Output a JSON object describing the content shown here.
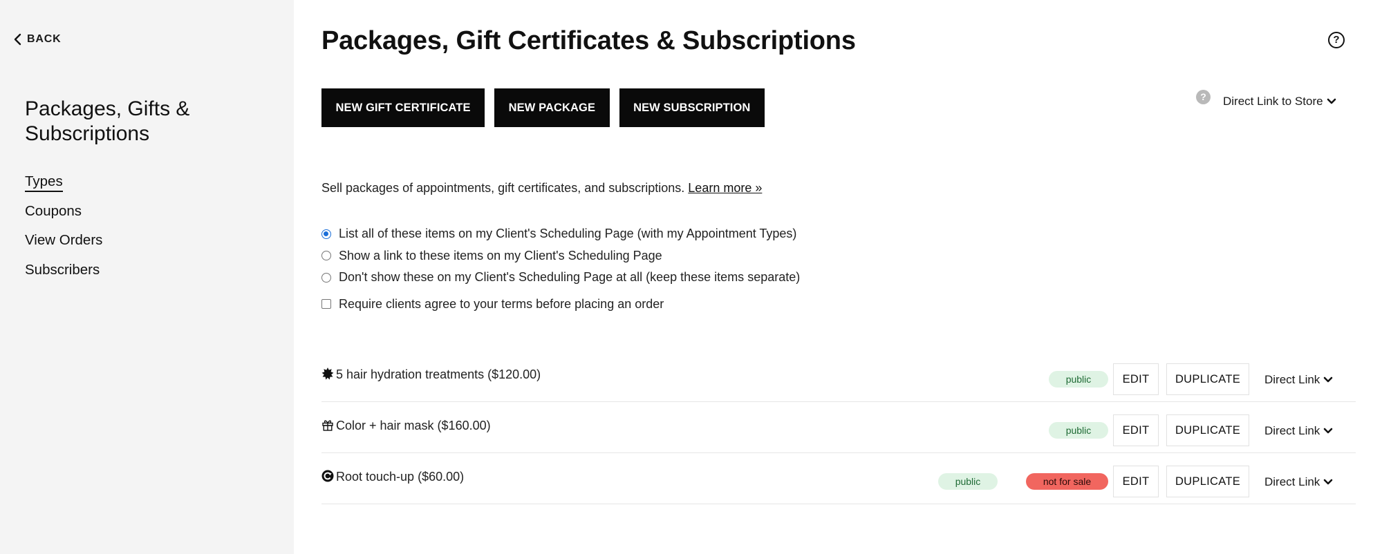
{
  "sidebar": {
    "back_label": "BACK",
    "title": "Packages, Gifts & Subscriptions",
    "nav": [
      {
        "label": "Types",
        "active": true
      },
      {
        "label": "Coupons",
        "active": false
      },
      {
        "label": "View Orders",
        "active": false
      },
      {
        "label": "Subscribers",
        "active": false
      }
    ]
  },
  "header": {
    "title": "Packages, Gift Certificates & Subscriptions",
    "help_icon": "?"
  },
  "toolbar": {
    "new_gift": "NEW GIFT CERTIFICATE",
    "new_package": "NEW PACKAGE",
    "new_subscription": "NEW SUBSCRIPTION",
    "store_help_icon": "?",
    "store_link": "Direct Link to Store"
  },
  "description": {
    "text": "Sell packages of appointments, gift certificates, and subscriptions.",
    "link": "Learn more »"
  },
  "options": {
    "radios": [
      {
        "label": "List all of these items on my Client's Scheduling Page (with my Appointment Types)",
        "selected": true
      },
      {
        "label": "Show a link to these items on my Client's Scheduling Page",
        "selected": false
      },
      {
        "label": "Don't show these on my Client's Scheduling Page at all (keep these items separate)",
        "selected": false
      }
    ],
    "terms_checkbox": {
      "label": "Require clients agree to your terms before placing an order",
      "checked": false
    }
  },
  "items": [
    {
      "icon": "package-icon",
      "name": "5 hair hydration treatments ($120.00)",
      "public_badge": "public",
      "sale_badge": "",
      "edit": "EDIT",
      "duplicate": "DUPLICATE",
      "direct_link": "Direct Link"
    },
    {
      "icon": "gift-icon",
      "name": "Color + hair mask ($160.00)",
      "public_badge": "public",
      "sale_badge": "",
      "edit": "EDIT",
      "duplicate": "DUPLICATE",
      "direct_link": "Direct Link"
    },
    {
      "icon": "subscription-icon",
      "name": "Root touch-up ($60.00)",
      "public_badge": "public",
      "sale_badge": "not for sale",
      "edit": "EDIT",
      "duplicate": "DUPLICATE",
      "direct_link": "Direct Link"
    }
  ],
  "colors": {
    "sidebar_bg": "#f4f4f4",
    "button_bg": "#0a0a0a",
    "public_badge_bg": "#dff3e4",
    "not_for_sale_bg": "#f1665f",
    "radio_accent": "#1a6ed8"
  }
}
